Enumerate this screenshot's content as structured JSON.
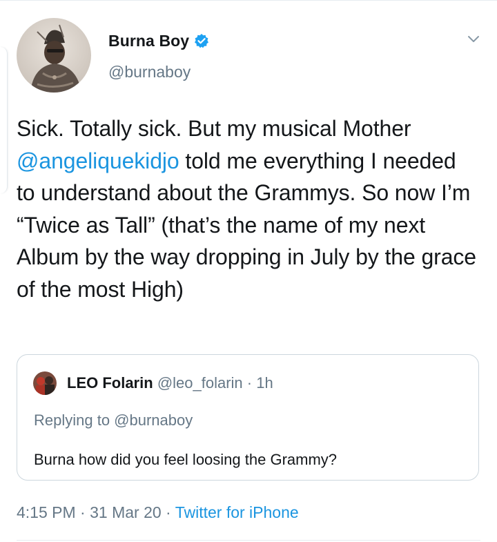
{
  "tweet": {
    "author": {
      "display_name": "Burna Boy",
      "handle": "@burnaboy",
      "verified": true,
      "verified_icon": "verified-badge-icon",
      "verified_color": "#1da1f2"
    },
    "text": {
      "part1": "Sick. Totally sick. But my musical Mother ",
      "mention": "@angeliquekidjo",
      "part2": " told me everything I needed to understand about the Grammys. So now I’m “Twice as Tall” (that’s the name of my next Album by the way dropping in July by the grace of the most High)"
    },
    "quoted": {
      "display_name": "LEO Folarin",
      "handle": "@leo_folarin",
      "separator": " · ",
      "age": "1h",
      "replying_to": "Replying to @burnaboy",
      "text": "Burna how did you feel loosing the Grammy?"
    },
    "meta": {
      "time": "4:15 PM",
      "sep1": " · ",
      "date": "31 Mar 20",
      "sep2": " · ",
      "source": "Twitter for iPhone"
    }
  },
  "icons": {
    "menu": "chevron-down-icon"
  },
  "colors": {
    "link": "#1b95e0",
    "secondary_text": "#657786",
    "primary_text": "#14171a",
    "border": "#ccd6dd"
  }
}
